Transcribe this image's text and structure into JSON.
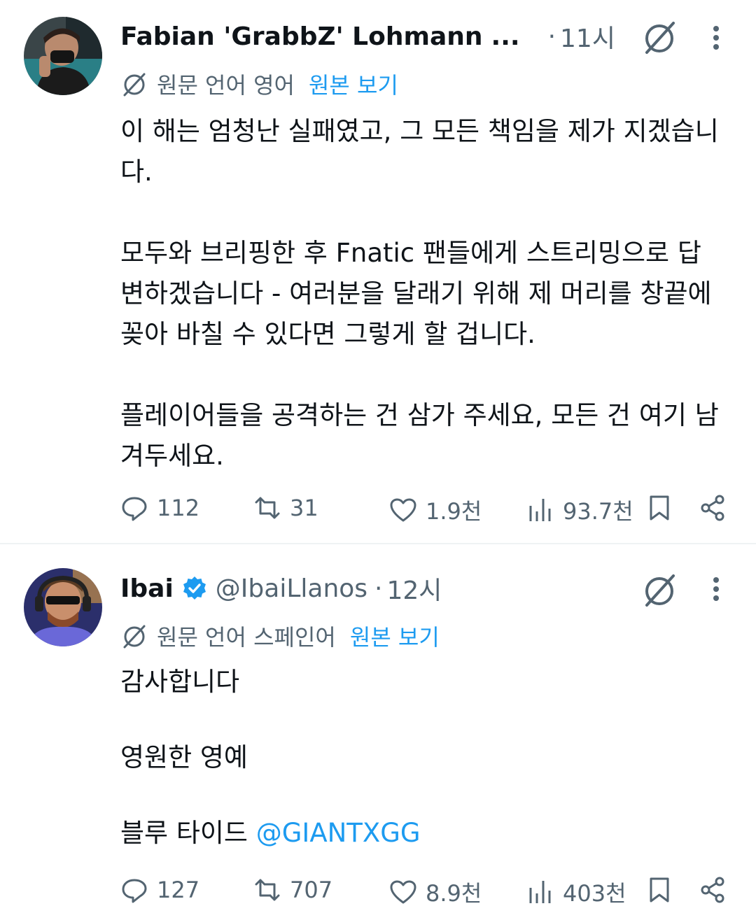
{
  "tweets": [
    {
      "author_name": "Fabian 'GrabbZ' Lohmann",
      "truncation": "...",
      "time": "11시",
      "translate_label": "원문 언어 영어",
      "translate_link": "원본 보기",
      "paragraphs": [
        "이 해는 엄청난 실패였고, 그 모든 책임을 제가 지겠습니다.",
        "모두와 브리핑한 후 Fnatic 팬들에게 스트리밍으로 답변하겠습니다 - 여러분을 달래기 위해 제 머리를 창끝에 꽂아 바칠 수 있다면 그렇게 할 겁니다.",
        "플레이어들을 공격하는 건 삼가 주세요, 모든 건 여기 남겨두세요."
      ],
      "replies": "112",
      "reposts": "31",
      "likes": "1.9천",
      "views": "93.7천"
    },
    {
      "author_name": "Ibai",
      "handle": "@IbaiLlanos",
      "time": "12시",
      "translate_label": "원문 언어 스페인어",
      "translate_link": "원본 보기",
      "paragraphs": [
        "감사합니다",
        "영원한 영예"
      ],
      "last_paragraph_prefix": "블루 타이드 ",
      "mention": "@GIANTXGG",
      "replies": "127",
      "reposts": "707",
      "likes": "8.9천",
      "views": "403천"
    }
  ],
  "colors": {
    "accent": "#1d9bf0",
    "text": "#0f1419",
    "muted": "#536471",
    "divider": "#eff3f4"
  },
  "icons": [
    "grok-icon",
    "more-icon",
    "translate-icon",
    "reply-icon",
    "repost-icon",
    "like-icon",
    "views-icon",
    "bookmark-icon",
    "share-icon",
    "verified-icon"
  ]
}
